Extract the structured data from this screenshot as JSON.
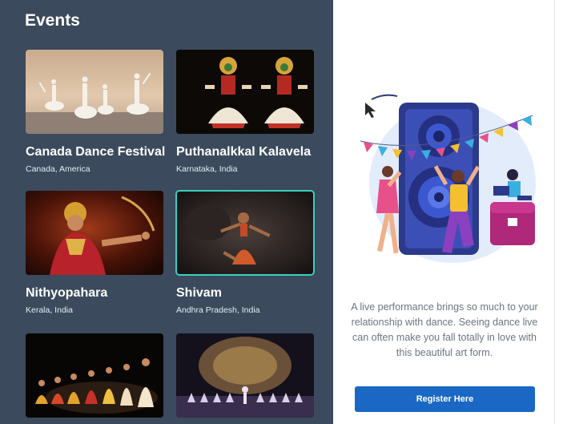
{
  "header": {
    "title": "Events"
  },
  "events": [
    {
      "title": "Canada Dance Festival",
      "location": "Canada, America"
    },
    {
      "title": "Puthanalkkal Kalavela",
      "location": "Karnataka, India"
    },
    {
      "title": "Nithyopahara",
      "location": "Kerala, India"
    },
    {
      "title": "Shivam",
      "location": "Andhra Pradesh, India"
    },
    {
      "title": "",
      "location": ""
    },
    {
      "title": "",
      "location": ""
    }
  ],
  "selected_event_index": 3,
  "promo": {
    "description": "A live performance brings so much to your relationship with dance. Seeing dance live can often make you fall totally in love with this beautiful art form.",
    "cta_label": "Register Here"
  },
  "colors": {
    "panel_bg": "#3b4a5c",
    "accent_button": "#1a68c4",
    "selection_border": "#39d0c0"
  }
}
